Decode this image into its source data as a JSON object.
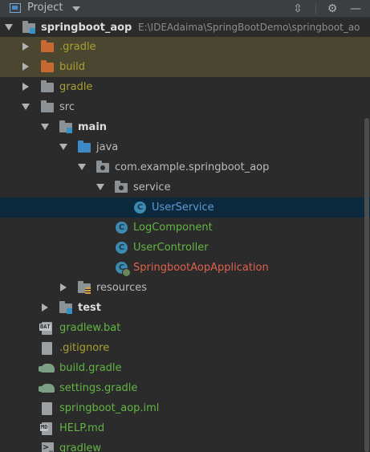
{
  "header": {
    "title": "Project",
    "buttons": [
      "collapse",
      "settings",
      "hide"
    ]
  },
  "tree": {
    "root": {
      "name": "springboot_aop",
      "path": "E:\\IDEAdaima\\SpringBootDemo\\springboot_ao"
    },
    "rows": [
      {
        "label": ".gradle",
        "state": "collapsed",
        "icon": "folder-orange"
      },
      {
        "label": "build",
        "state": "collapsed",
        "icon": "folder-orange"
      },
      {
        "label": "gradle",
        "state": "collapsed",
        "icon": "folder-grey"
      },
      {
        "label": "src",
        "state": "expanded",
        "icon": "folder-grey"
      },
      {
        "label": "main",
        "state": "expanded",
        "icon": "module-folder"
      },
      {
        "label": "java",
        "state": "expanded",
        "icon": "source-folder"
      },
      {
        "label": "com.example.springboot_aop",
        "state": "expanded",
        "icon": "package-folder"
      },
      {
        "label": "service",
        "state": "expanded",
        "icon": "package-folder"
      },
      {
        "label": "UserService",
        "state": "leaf",
        "icon": "class-icon",
        "selected": true
      },
      {
        "label": "LogComponent",
        "state": "leaf",
        "icon": "class-icon"
      },
      {
        "label": "UserController",
        "state": "leaf",
        "icon": "class-icon"
      },
      {
        "label": "SpringbootAopApplication",
        "state": "leaf",
        "icon": "spring-boot-class-icon"
      },
      {
        "label": "resources",
        "state": "collapsed",
        "icon": "resources-folder"
      },
      {
        "label": "test",
        "state": "collapsed",
        "icon": "module-folder"
      },
      {
        "label": "gradlew.bat",
        "state": "leaf",
        "icon": "bat-file-icon",
        "badge": "BAT"
      },
      {
        "label": ".gitignore",
        "state": "leaf",
        "icon": "ignore-file-icon"
      },
      {
        "label": "build.gradle",
        "state": "leaf",
        "icon": "gradle-icon"
      },
      {
        "label": "settings.gradle",
        "state": "leaf",
        "icon": "gradle-icon"
      },
      {
        "label": "springboot_aop.iml",
        "state": "leaf",
        "icon": "iml-file-icon"
      },
      {
        "label": "HELP.md",
        "state": "leaf",
        "icon": "markdown-file-icon",
        "badge": "MD"
      },
      {
        "label": "gradlew",
        "state": "leaf",
        "icon": "shell-file-icon",
        "badge": ">_"
      }
    ]
  },
  "colors": {
    "background": "#2b2b2b",
    "header": "#3c3f41",
    "excluded_row": "#4b4630",
    "selected_row": "#0d293e",
    "excluded_text": "#a8a032",
    "new_file_text": "#62b543",
    "modified_text": "#e0604e",
    "selected_text": "#5e9ad1"
  }
}
